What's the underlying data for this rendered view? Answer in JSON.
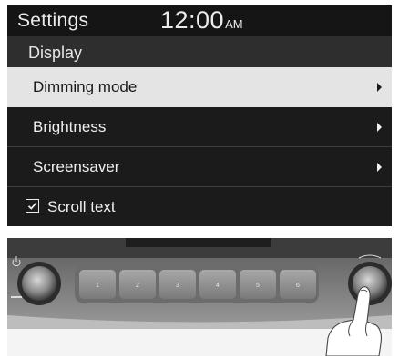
{
  "status_bar": {
    "title": "Settings",
    "time": "12:00",
    "ampm": "AM"
  },
  "section": {
    "title": "Display"
  },
  "menu": [
    {
      "label": "Dimming mode",
      "selected": true
    },
    {
      "label": "Brightness",
      "selected": false
    },
    {
      "label": "Screensaver",
      "selected": false
    }
  ],
  "scroll_text": {
    "label": "Scroll text",
    "checked": true
  },
  "preset_buttons": [
    "1",
    "2",
    "3",
    "4",
    "5",
    "6"
  ],
  "colors": {
    "screen_bg": "#1b1b1b",
    "selected_bg": "#e4e4e4",
    "text": "#efefef"
  },
  "icons": [
    "power-icon",
    "arrow-right-icon",
    "checkbox-checked-icon"
  ]
}
